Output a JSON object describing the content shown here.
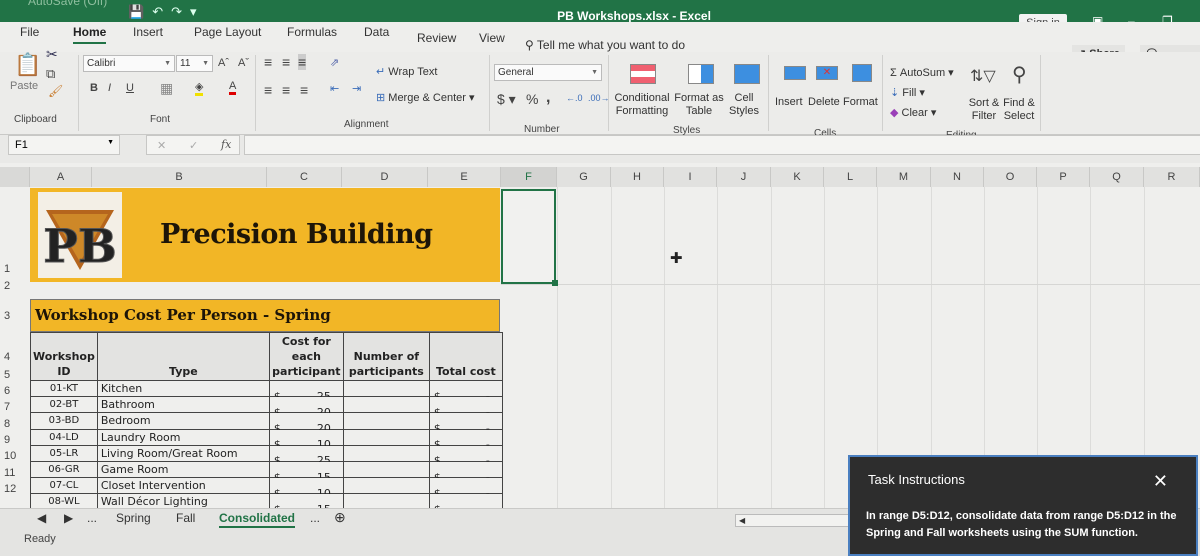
{
  "window": {
    "title": "PB Workshops.xlsx - Excel",
    "autosave_label": "AutoSave",
    "autosave_state": "Off",
    "sign_in": "Sign in"
  },
  "ribbon_tabs": [
    "File",
    "Home",
    "Insert",
    "Page Layout",
    "Formulas",
    "Data",
    "Review",
    "View"
  ],
  "active_tab": "Home",
  "tell_me": "Tell me what you want to do",
  "share_label": "Share",
  "comments_label": "Comments",
  "ribbon": {
    "clipboard": {
      "paste": "Paste",
      "group": "Clipboard"
    },
    "font": {
      "name": "Calibri",
      "size": "11",
      "bold": "B",
      "italic": "I",
      "underline": "U",
      "group": "Font"
    },
    "alignment": {
      "wrap_text": "Wrap Text",
      "merge_center": "Merge & Center",
      "group": "Alignment"
    },
    "number": {
      "format": "General",
      "currency": "$",
      "percent": "%",
      "comma": ",",
      "group": "Number"
    },
    "styles": {
      "conditional": "Conditional Formatting",
      "format_table": "Format as Table",
      "cell_styles": "Cell Styles",
      "group": "Styles"
    },
    "cells": {
      "insert": "Insert",
      "delete": "Delete",
      "format": "Format",
      "group": "Cells"
    },
    "editing": {
      "autosum": "AutoSum",
      "fill": "Fill",
      "clear": "Clear",
      "sort_filter": "Sort & Filter",
      "find_select": "Find & Select",
      "group": "Editing"
    }
  },
  "formula_bar": {
    "name_box": "F1",
    "fx": "fx",
    "value": ""
  },
  "columns": [
    "A",
    "B",
    "C",
    "D",
    "E",
    "F",
    "G",
    "H",
    "I",
    "J",
    "K",
    "L",
    "M",
    "N",
    "O",
    "P",
    "Q",
    "R"
  ],
  "selected_column": "F",
  "rows": [
    "1",
    "2",
    "3",
    "4",
    "5",
    "6",
    "7",
    "8",
    "9",
    "10",
    "11",
    "12"
  ],
  "sheet": {
    "banner_title": "Precision Building",
    "logo_text": "PB",
    "subtitle": "Workshop Cost Per Person - Spring",
    "headers": [
      "Workshop ID",
      "Type",
      "Cost for each participant",
      "Number of participants",
      "Total cost"
    ],
    "rows": [
      {
        "id": "01-KT",
        "type": "Kitchen",
        "cost": "25",
        "participants": "",
        "total": "-"
      },
      {
        "id": "02-BT",
        "type": "Bathroom",
        "cost": "20",
        "participants": "",
        "total": "-"
      },
      {
        "id": "03-BD",
        "type": "Bedroom",
        "cost": "20",
        "participants": "",
        "total": "-"
      },
      {
        "id": "04-LD",
        "type": "Laundry Room",
        "cost": "10",
        "participants": "",
        "total": "-"
      },
      {
        "id": "05-LR",
        "type": "Living Room/Great Room",
        "cost": "25",
        "participants": "",
        "total": "-"
      },
      {
        "id": "06-GR",
        "type": "Game Room",
        "cost": "15",
        "participants": "",
        "total": "-"
      },
      {
        "id": "07-CL",
        "type": "Closet Intervention",
        "cost": "10",
        "participants": "",
        "total": "-"
      },
      {
        "id": "08-WL",
        "type": "Wall Décor Lighting",
        "cost": "15",
        "participants": "",
        "total": "-"
      }
    ],
    "currency_symbol": "$"
  },
  "sheet_tabs": [
    "Spring",
    "Fall",
    "Consolidated"
  ],
  "active_sheet": "Consolidated",
  "status": "Ready",
  "task": {
    "title": "Task Instructions",
    "body": "In range D5:D12, consolidate data from range D5:D12 in the Spring and Fall worksheets using the SUM function."
  }
}
